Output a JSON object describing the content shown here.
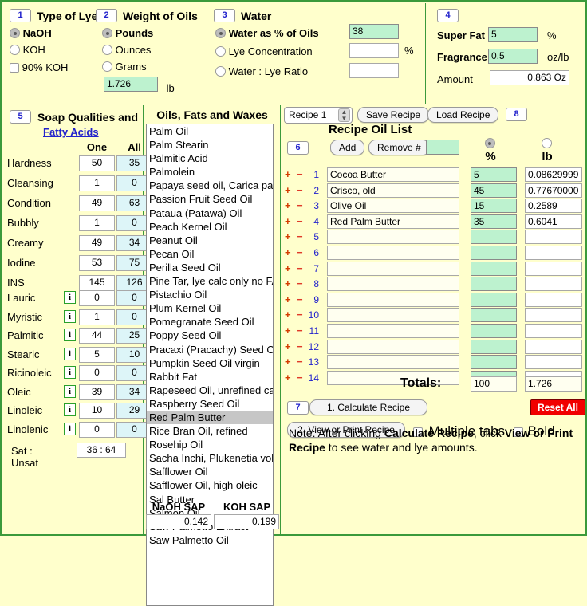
{
  "colors": {
    "page_bg": "#ffffcc",
    "border_green": "#3b9a3b",
    "input_green": "#bdf2cf",
    "input_cyan": "#ddf5f8",
    "accent_blue": "#2222cc",
    "reset_red": "#f10000",
    "plus_red": "#d43a00"
  },
  "lye": {
    "step": "1",
    "title": "Type of Lye",
    "options": [
      "NaOH",
      "KOH"
    ],
    "selected": "NaOH",
    "checkbox_label": "90% KOH",
    "checkbox_checked": false
  },
  "weight": {
    "step": "2",
    "title": "Weight of Oils",
    "options": [
      "Pounds",
      "Ounces",
      "Grams"
    ],
    "selected": "Pounds",
    "value": "1.726",
    "unit": "lb"
  },
  "water": {
    "step": "3",
    "title": "Water",
    "options": [
      "Water as % of Oils",
      "Lye Concentration",
      "Water : Lye Ratio"
    ],
    "selected": "Water as % of Oils",
    "percent_of_oils": "38",
    "lye_concentration": "",
    "lye_concentration_unit": "%",
    "water_lye_ratio": ""
  },
  "superfat": {
    "step": "4",
    "superfat_label": "Super Fat",
    "superfat_value": "5",
    "superfat_unit": "%",
    "fragrance_label": "Fragrance",
    "fragrance_value": "0.5",
    "fragrance_unit": "oz/lb",
    "amount_label": "Amount",
    "amount_value": "0.863 Oz"
  },
  "qualities": {
    "step": "5",
    "title": "Soap Qualities and",
    "link": "Fatty Acids",
    "col_one": "One",
    "col_all": "All",
    "rows": [
      {
        "name": "Hardness",
        "one": "50",
        "all": "35"
      },
      {
        "name": "Cleansing",
        "one": "1",
        "all": "0"
      },
      {
        "name": "Condition",
        "one": "49",
        "all": "63"
      },
      {
        "name": "Bubbly",
        "one": "1",
        "all": "0"
      },
      {
        "name": "Creamy",
        "one": "49",
        "all": "34"
      },
      {
        "name": "Iodine",
        "one": "53",
        "all": "75"
      },
      {
        "name": "INS",
        "one": "145",
        "all": "126"
      }
    ],
    "acids": [
      {
        "name": "Lauric",
        "info": "i",
        "one": "0",
        "all": "0"
      },
      {
        "name": "Myristic",
        "info": "i",
        "one": "1",
        "all": "0"
      },
      {
        "name": "Palmitic",
        "info": "i",
        "one": "44",
        "all": "25"
      },
      {
        "name": "Stearic",
        "info": "i",
        "one": "5",
        "all": "10"
      },
      {
        "name": "Ricinoleic",
        "info": "i",
        "one": "0",
        "all": "0"
      },
      {
        "name": "Oleic",
        "info": "i",
        "one": "39",
        "all": "34"
      },
      {
        "name": "Linoleic",
        "info": "i",
        "one": "10",
        "all": "29"
      },
      {
        "name": "Linolenic",
        "info": "i",
        "one": "0",
        "all": "0"
      }
    ],
    "sat_label": "Sat : Unsat",
    "sat_value": "36 : 64"
  },
  "oils": {
    "title": "Oils, Fats and Waxes",
    "selected": "Red Palm Butter",
    "items": [
      "Palm Oil",
      "Palm Stearin",
      "Palmitic Acid",
      "Palmolein",
      "Papaya seed oil, Carica pap",
      "Passion Fruit Seed Oil",
      "Pataua (Patawa) Oil",
      "Peach Kernel Oil",
      "Peanut Oil",
      "Pecan Oil",
      "Perilla Seed Oil",
      "Pine Tar, lye calc only no FA",
      "Pistachio Oil",
      "Plum Kernel Oil",
      "Pomegranate Seed Oil",
      "Poppy Seed Oil",
      "Pracaxi (Pracachy) Seed Oil",
      "Pumpkin Seed Oil virgin",
      "Rabbit Fat",
      "Rapeseed Oil, unrefined can",
      "Raspberry Seed Oil",
      "Red Palm Butter",
      "Rice Bran Oil, refined",
      "Rosehip Oil",
      "Sacha Inchi, Plukenetia volu",
      "Safflower Oil",
      "Safflower Oil, high oleic",
      "Sal Butter",
      "Salmon Oil",
      "Saw Palmetto Extract",
      "Saw Palmetto Oil"
    ],
    "naoh_sap_label": "NaOH SAP",
    "koh_sap_label": "KOH SAP",
    "naoh_sap_value": "0.142",
    "koh_sap_value": "0.199"
  },
  "recipe": {
    "select_value": "Recipe 1",
    "save_label": "Save Recipe",
    "load_label": "Load Recipe",
    "step8": "8",
    "list_title": "Recipe Oil List",
    "step6": "6",
    "add_label": "Add",
    "remove_label": "Remove #",
    "remove_value": "",
    "unit_percent": "%",
    "unit_lb": "lb",
    "unit_selected": "%",
    "rows": [
      {
        "n": "1",
        "oil": "Cocoa Butter",
        "pct": "5",
        "lb": "0.08629999"
      },
      {
        "n": "2",
        "oil": "Crisco, old",
        "pct": "45",
        "lb": "0.77670000"
      },
      {
        "n": "3",
        "oil": "Olive Oil",
        "pct": "15",
        "lb": "0.2589"
      },
      {
        "n": "4",
        "oil": "Red Palm Butter",
        "pct": "35",
        "lb": "0.6041"
      },
      {
        "n": "5",
        "oil": "",
        "pct": "",
        "lb": ""
      },
      {
        "n": "6",
        "oil": "",
        "pct": "",
        "lb": ""
      },
      {
        "n": "7",
        "oil": "",
        "pct": "",
        "lb": ""
      },
      {
        "n": "8",
        "oil": "",
        "pct": "",
        "lb": ""
      },
      {
        "n": "9",
        "oil": "",
        "pct": "",
        "lb": ""
      },
      {
        "n": "10",
        "oil": "",
        "pct": "",
        "lb": ""
      },
      {
        "n": "11",
        "oil": "",
        "pct": "",
        "lb": ""
      },
      {
        "n": "12",
        "oil": "",
        "pct": "",
        "lb": ""
      },
      {
        "n": "13",
        "oil": "",
        "pct": "",
        "lb": ""
      },
      {
        "n": "14",
        "oil": "",
        "pct": "",
        "lb": ""
      }
    ],
    "totals_label": "Totals:",
    "totals_pct": "100",
    "totals_lb": "1.726",
    "step7": "7",
    "calculate_label": "1. Calculate Recipe",
    "view_print_label": "2. View or Print Recipe",
    "reset_label": "Reset All",
    "multiple_tabs_label": "Multiple tabs",
    "bold_label": "Bold",
    "note_prefix": "Note: After clicking ",
    "note_bold1": "Calculate Recipe",
    "note_mid": ", click ",
    "note_bold2": "View or Print Recipe",
    "note_suffix": " to see water and lye amounts."
  }
}
